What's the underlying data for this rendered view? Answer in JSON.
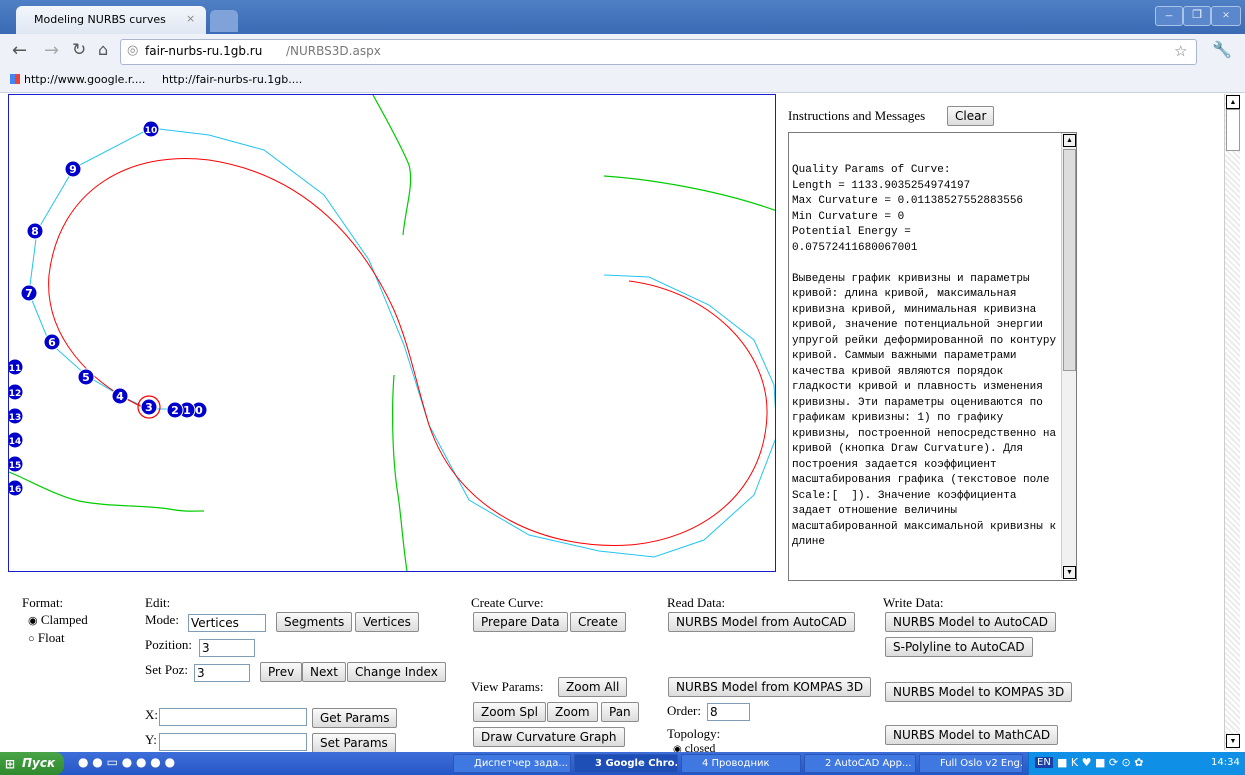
{
  "browser": {
    "tab_title": "Modeling NURBS curves",
    "url_host": "fair-nurbs-ru.1gb.ru",
    "url_path": "/NURBS3D.aspx",
    "bookmarks": [
      "http://www.google.r....",
      "http://fair-nurbs-ru.1gb...."
    ]
  },
  "messages": {
    "title": "Instructions and Messages",
    "clear_label": "Clear",
    "text": "Quality Params of Curve:\nLength = 1133.9035254974197\nMax Curvature = 0.011385275528835​56\nMin Curvature = 0\nPotential Energy =\n0.07572411680067001\n\nВыведены график кривизны и параметры кривой: длина кривой, максимальная кривизна кривой, минимальная кривизна кривой, значение потенциальной энергии упругой рейки деформированной по контуру кривой. Саммыи важными параметрами качества кривой являются порядок гладкости кривой и плавность изменения кривизны. Эти параметры оцениваются по графикам кривизны: 1) по графику кривизны, построенной непосредственно на кривой (кнопка Draw Curvature). Для построения задается коэффициент масштабирования графика (текстовое поле Scale:[  ]). Значение коэффициента задает отношение величины масштабированной максимальной кривизны к длине"
  },
  "canvas": {
    "vertex_labels": [
      "0",
      "1",
      "2",
      "3",
      "4",
      "5",
      "6",
      "7",
      "8",
      "9",
      "10",
      "11",
      "12",
      "13",
      "14",
      "15",
      "16"
    ]
  },
  "format": {
    "label": "Format:",
    "options": [
      "Clamped",
      "Float"
    ],
    "selected": "Clamped"
  },
  "edit": {
    "label": "Edit:",
    "mode_label": "Mode:",
    "mode_value": "Vertices",
    "segments_label": "Segments",
    "vertices_label": "Vertices",
    "position_label": "Pozition:",
    "position_value": "3",
    "setpoz_label": "Set Poz:",
    "setpoz_value": "3",
    "prev_label": "Prev",
    "next_label": "Next",
    "change_index_label": "Change Index",
    "x_label": "X:",
    "y_label": "Y:",
    "get_params_label": "Get Params",
    "set_params_label": "Set Params"
  },
  "create": {
    "label": "Create Curve:",
    "prepare_label": "Prepare Data",
    "create_label": "Create"
  },
  "view": {
    "label": "View Params:",
    "zoom_all_label": "Zoom All",
    "zoom_spl_label": "Zoom Spl",
    "zoom_label": "Zoom",
    "pan_label": "Pan",
    "draw_curvature_label": "Draw Curvature Graph"
  },
  "read": {
    "label": "Read Data:",
    "autocad_label": "NURBS Model from AutoCAD",
    "kompas_label": "NURBS Model from KOMPAS 3D",
    "order_label": "Order:",
    "order_value": "8",
    "topology_label": "Topology:",
    "topology_option": "closed"
  },
  "write": {
    "label": "Write Data:",
    "autocad_label": "NURBS Model to AutoCAD",
    "polyline_label": "S-Polyline to AutoCAD",
    "kompas_label": "NURBS Model to KOMPAS 3D",
    "mathcad_label": "NURBS Model to MathCAD"
  },
  "taskbar": {
    "start_label": "Пуск",
    "tasks": [
      "Диспетчер зада...",
      "3 Google Chro...",
      "4 Проводник",
      "2 AutoCAD App...",
      "Full Oslo v2 Eng..."
    ],
    "lang": "EN",
    "clock": "14:34"
  },
  "colors": {
    "curve": "#ff0000",
    "polygon": "#22c4f0",
    "curvature": "#00cc00",
    "vertex": "#0000cc",
    "canvas_border": "#1a1ad0"
  }
}
